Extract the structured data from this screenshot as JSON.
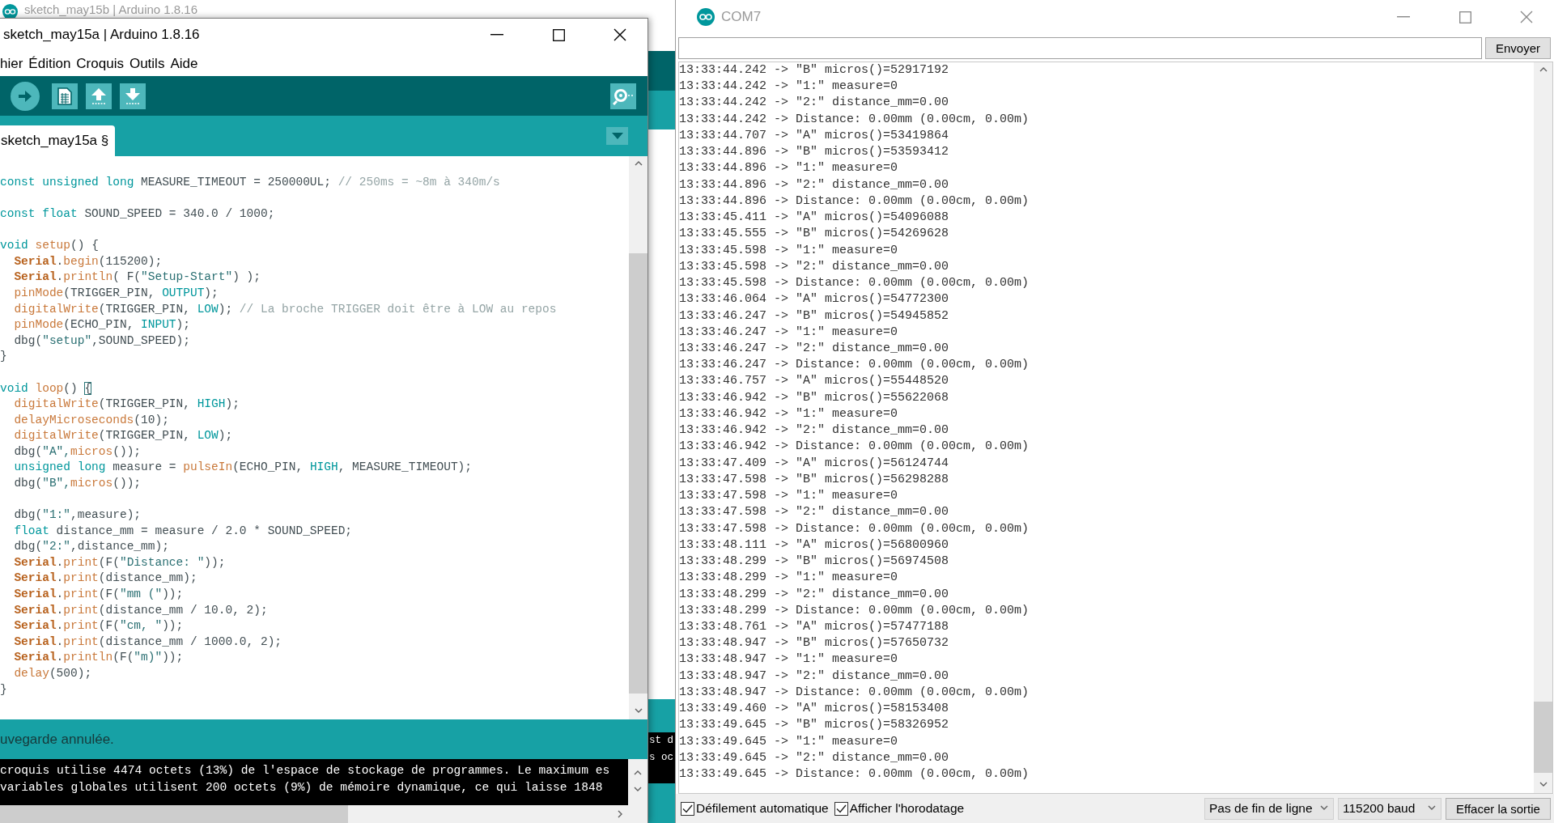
{
  "back_window": {
    "title": "sketch_may15b | Arduino 1.8.16",
    "console_lines": [
      "st d",
      "s oc"
    ]
  },
  "editor_window": {
    "title": "sketch_may15a | Arduino 1.8.16",
    "menu": [
      "hier",
      "Édition",
      "Croquis",
      "Outils",
      "Aide"
    ],
    "tabs": [
      {
        "label": "sketch_may15a §",
        "selected": true
      }
    ],
    "code_blocks": [
      [
        {
          "indented": false,
          "tokens": [
            {
              "text": "const unsigned long",
              "kind": "keyword"
            },
            {
              "text": " MEASURE_TIMEOUT = 250000UL; ",
              "kind": "plain"
            },
            {
              "text": "// 250ms = ~8m à 340m/s",
              "kind": "comment"
            }
          ]
        }
      ],
      [
        {
          "indented": false,
          "tokens": [
            {
              "text": "const float",
              "kind": "keyword"
            },
            {
              "text": " SOUND_SPEED = 340.0 / 1000;",
              "kind": "plain"
            }
          ]
        }
      ],
      [
        {
          "indented": false,
          "tokens": [
            {
              "text": "void ",
              "kind": "keyword"
            },
            {
              "text": "setup",
              "kind": "function"
            },
            {
              "text": "() {",
              "kind": "plain"
            }
          ]
        },
        {
          "indented": true,
          "tokens": [
            {
              "text": "Serial",
              "kind": "object"
            },
            {
              "text": ".",
              "kind": "plain"
            },
            {
              "text": "begin",
              "kind": "function"
            },
            {
              "text": "(115200);",
              "kind": "plain"
            }
          ]
        },
        {
          "indented": true,
          "tokens": [
            {
              "text": "Serial",
              "kind": "object"
            },
            {
              "text": ".",
              "kind": "plain"
            },
            {
              "text": "println",
              "kind": "function"
            },
            {
              "text": "( F(",
              "kind": "plain"
            },
            {
              "text": "\"Setup-Start\"",
              "kind": "string"
            },
            {
              "text": ") );",
              "kind": "plain"
            }
          ]
        },
        {
          "indented": true,
          "tokens": [
            {
              "text": "pinMode",
              "kind": "function"
            },
            {
              "text": "(TRIGGER_PIN, ",
              "kind": "plain"
            },
            {
              "text": "OUTPUT",
              "kind": "constant"
            },
            {
              "text": ");",
              "kind": "plain"
            }
          ]
        },
        {
          "indented": true,
          "tokens": [
            {
              "text": "digitalWrite",
              "kind": "function"
            },
            {
              "text": "(TRIGGER_PIN, ",
              "kind": "plain"
            },
            {
              "text": "LOW",
              "kind": "constant"
            },
            {
              "text": "); ",
              "kind": "plain"
            },
            {
              "text": "// La broche TRIGGER doit être à LOW au repos",
              "kind": "comment"
            }
          ]
        },
        {
          "indented": true,
          "tokens": [
            {
              "text": "pinMode",
              "kind": "function"
            },
            {
              "text": "(ECHO_PIN, ",
              "kind": "plain"
            },
            {
              "text": "INPUT",
              "kind": "constant"
            },
            {
              "text": ");",
              "kind": "plain"
            }
          ]
        },
        {
          "indented": true,
          "tokens": [
            {
              "text": "dbg(",
              "kind": "plain"
            },
            {
              "text": "\"setup\"",
              "kind": "string"
            },
            {
              "text": ",SOUND_SPEED);",
              "kind": "plain"
            }
          ]
        },
        {
          "indented": false,
          "tokens": [
            {
              "text": "}",
              "kind": "plain"
            }
          ]
        }
      ],
      [
        {
          "indented": false,
          "tokens": [
            {
              "text": "void ",
              "kind": "keyword"
            },
            {
              "text": "loop",
              "kind": "function"
            },
            {
              "text": "() ",
              "kind": "plain"
            },
            {
              "text": "{",
              "kind": "matched-bracket"
            }
          ]
        },
        {
          "indented": true,
          "tokens": [
            {
              "text": "digitalWrite",
              "kind": "function"
            },
            {
              "text": "(TRIGGER_PIN, ",
              "kind": "plain"
            },
            {
              "text": "HIGH",
              "kind": "constant"
            },
            {
              "text": ");",
              "kind": "plain"
            }
          ]
        },
        {
          "indented": true,
          "tokens": [
            {
              "text": "delayMicroseconds",
              "kind": "function"
            },
            {
              "text": "(10);",
              "kind": "plain"
            }
          ]
        },
        {
          "indented": true,
          "tokens": [
            {
              "text": "digitalWrite",
              "kind": "function"
            },
            {
              "text": "(TRIGGER_PIN, ",
              "kind": "plain"
            },
            {
              "text": "LOW",
              "kind": "constant"
            },
            {
              "text": ");",
              "kind": "plain"
            }
          ]
        },
        {
          "indented": true,
          "tokens": [
            {
              "text": "dbg(",
              "kind": "plain"
            },
            {
              "text": "\"A\",",
              "kind": "string"
            },
            {
              "text": "micros",
              "kind": "function"
            },
            {
              "text": "());",
              "kind": "plain"
            }
          ]
        },
        {
          "indented": true,
          "tokens": [
            {
              "text": "unsigned long",
              "kind": "keyword"
            },
            {
              "text": " measure = ",
              "kind": "plain"
            },
            {
              "text": "pulseIn",
              "kind": "function"
            },
            {
              "text": "(ECHO_PIN, ",
              "kind": "plain"
            },
            {
              "text": "HIGH",
              "kind": "constant"
            },
            {
              "text": ", MEASURE_TIMEOUT);",
              "kind": "plain"
            }
          ]
        },
        {
          "indented": true,
          "tokens": [
            {
              "text": "dbg(",
              "kind": "plain"
            },
            {
              "text": "\"B\",",
              "kind": "string"
            },
            {
              "text": "micros",
              "kind": "function"
            },
            {
              "text": "());",
              "kind": "plain"
            }
          ]
        }
      ],
      [
        {
          "indented": true,
          "tokens": [
            {
              "text": "dbg(",
              "kind": "plain"
            },
            {
              "text": "\"1:\"",
              "kind": "string"
            },
            {
              "text": ",measure);",
              "kind": "plain"
            }
          ]
        },
        {
          "indented": true,
          "tokens": [
            {
              "text": "float",
              "kind": "keyword"
            },
            {
              "text": " distance_mm = measure / 2.0 * SOUND_SPEED;",
              "kind": "plain"
            }
          ]
        },
        {
          "indented": true,
          "tokens": [
            {
              "text": "dbg(",
              "kind": "plain"
            },
            {
              "text": "\"2:\"",
              "kind": "string"
            },
            {
              "text": ",distance_mm);",
              "kind": "plain"
            }
          ]
        },
        {
          "indented": true,
          "tokens": [
            {
              "text": "Serial",
              "kind": "object"
            },
            {
              "text": ".",
              "kind": "plain"
            },
            {
              "text": "print",
              "kind": "function"
            },
            {
              "text": "(F(",
              "kind": "plain"
            },
            {
              "text": "\"Distance: \"",
              "kind": "string"
            },
            {
              "text": "));",
              "kind": "plain"
            }
          ]
        },
        {
          "indented": true,
          "tokens": [
            {
              "text": "Serial",
              "kind": "object"
            },
            {
              "text": ".",
              "kind": "plain"
            },
            {
              "text": "print",
              "kind": "function"
            },
            {
              "text": "(distance_mm);",
              "kind": "plain"
            }
          ]
        },
        {
          "indented": true,
          "tokens": [
            {
              "text": "Serial",
              "kind": "object"
            },
            {
              "text": ".",
              "kind": "plain"
            },
            {
              "text": "print",
              "kind": "function"
            },
            {
              "text": "(F(",
              "kind": "plain"
            },
            {
              "text": "\"mm (\"",
              "kind": "string"
            },
            {
              "text": "));",
              "kind": "plain"
            }
          ]
        },
        {
          "indented": true,
          "tokens": [
            {
              "text": "Serial",
              "kind": "object"
            },
            {
              "text": ".",
              "kind": "plain"
            },
            {
              "text": "print",
              "kind": "function"
            },
            {
              "text": "(distance_mm / 10.0, 2);",
              "kind": "plain"
            }
          ]
        },
        {
          "indented": true,
          "tokens": [
            {
              "text": "Serial",
              "kind": "object"
            },
            {
              "text": ".",
              "kind": "plain"
            },
            {
              "text": "print",
              "kind": "function"
            },
            {
              "text": "(F(",
              "kind": "plain"
            },
            {
              "text": "\"cm, \"",
              "kind": "string"
            },
            {
              "text": "));",
              "kind": "plain"
            }
          ]
        },
        {
          "indented": true,
          "tokens": [
            {
              "text": "Serial",
              "kind": "object"
            },
            {
              "text": ".",
              "kind": "plain"
            },
            {
              "text": "print",
              "kind": "function"
            },
            {
              "text": "(distance_mm / 1000.0, 2);",
              "kind": "plain"
            }
          ]
        },
        {
          "indented": true,
          "tokens": [
            {
              "text": "Serial",
              "kind": "object"
            },
            {
              "text": ".",
              "kind": "plain"
            },
            {
              "text": "println",
              "kind": "function"
            },
            {
              "text": "(F(",
              "kind": "plain"
            },
            {
              "text": "\"m)\"",
              "kind": "string"
            },
            {
              "text": "));",
              "kind": "plain"
            }
          ]
        },
        {
          "indented": true,
          "tokens": [
            {
              "text": "delay",
              "kind": "function"
            },
            {
              "text": "(500);",
              "kind": "plain"
            }
          ]
        },
        {
          "indented": false,
          "tokens": [
            {
              "text": "}",
              "kind": "plain"
            }
          ]
        }
      ]
    ],
    "status": "uvegarde annulée.",
    "console_lines": [
      "croquis utilise 4474 octets (13%) de l'espace de stockage de programmes. Le maximum es",
      "variables globales utilisent 200 octets (9%) de mémoire dynamique, ce qui laisse 1848"
    ]
  },
  "serial_monitor": {
    "title": "COM7",
    "send_button": "Envoyer",
    "log": [
      "13:33:44.242 -> \"B\" micros()=52917192",
      "13:33:44.242 -> \"1:\" measure=0",
      "13:33:44.242 -> \"2:\" distance_mm=0.00",
      "13:33:44.242 -> Distance: 0.00mm (0.00cm, 0.00m)",
      "13:33:44.707 -> \"A\" micros()=53419864",
      "13:33:44.896 -> \"B\" micros()=53593412",
      "13:33:44.896 -> \"1:\" measure=0",
      "13:33:44.896 -> \"2:\" distance_mm=0.00",
      "13:33:44.896 -> Distance: 0.00mm (0.00cm, 0.00m)",
      "13:33:45.411 -> \"A\" micros()=54096088",
      "13:33:45.555 -> \"B\" micros()=54269628",
      "13:33:45.598 -> \"1:\" measure=0",
      "13:33:45.598 -> \"2:\" distance_mm=0.00",
      "13:33:45.598 -> Distance: 0.00mm (0.00cm, 0.00m)",
      "13:33:46.064 -> \"A\" micros()=54772300",
      "13:33:46.247 -> \"B\" micros()=54945852",
      "13:33:46.247 -> \"1:\" measure=0",
      "13:33:46.247 -> \"2:\" distance_mm=0.00",
      "13:33:46.247 -> Distance: 0.00mm (0.00cm, 0.00m)",
      "13:33:46.757 -> \"A\" micros()=55448520",
      "13:33:46.942 -> \"B\" micros()=55622068",
      "13:33:46.942 -> \"1:\" measure=0",
      "13:33:46.942 -> \"2:\" distance_mm=0.00",
      "13:33:46.942 -> Distance: 0.00mm (0.00cm, 0.00m)",
      "13:33:47.409 -> \"A\" micros()=56124744",
      "13:33:47.598 -> \"B\" micros()=56298288",
      "13:33:47.598 -> \"1:\" measure=0",
      "13:33:47.598 -> \"2:\" distance_mm=0.00",
      "13:33:47.598 -> Distance: 0.00mm (0.00cm, 0.00m)",
      "13:33:48.111 -> \"A\" micros()=56800960",
      "13:33:48.299 -> \"B\" micros()=56974508",
      "13:33:48.299 -> \"1:\" measure=0",
      "13:33:48.299 -> \"2:\" distance_mm=0.00",
      "13:33:48.299 -> Distance: 0.00mm (0.00cm, 0.00m)",
      "13:33:48.761 -> \"A\" micros()=57477188",
      "13:33:48.947 -> \"B\" micros()=57650732",
      "13:33:48.947 -> \"1:\" measure=0",
      "13:33:48.947 -> \"2:\" distance_mm=0.00",
      "13:33:48.947 -> Distance: 0.00mm (0.00cm, 0.00m)",
      "13:33:49.460 -> \"A\" micros()=58153408",
      "13:33:49.645 -> \"B\" micros()=58326952",
      "13:33:49.645 -> \"1:\" measure=0",
      "13:33:49.645 -> \"2:\" distance_mm=0.00",
      "13:33:49.645 -> Distance: 0.00mm (0.00cm, 0.00m)"
    ],
    "autoscroll": {
      "label": "Défilement automatique",
      "checked": true
    },
    "timestamp": {
      "label": "Afficher l'horodatage",
      "checked": true
    },
    "line_ending": "Pas de fin de ligne",
    "baud": "115200 baud",
    "clear_button": "Effacer la sortie"
  }
}
